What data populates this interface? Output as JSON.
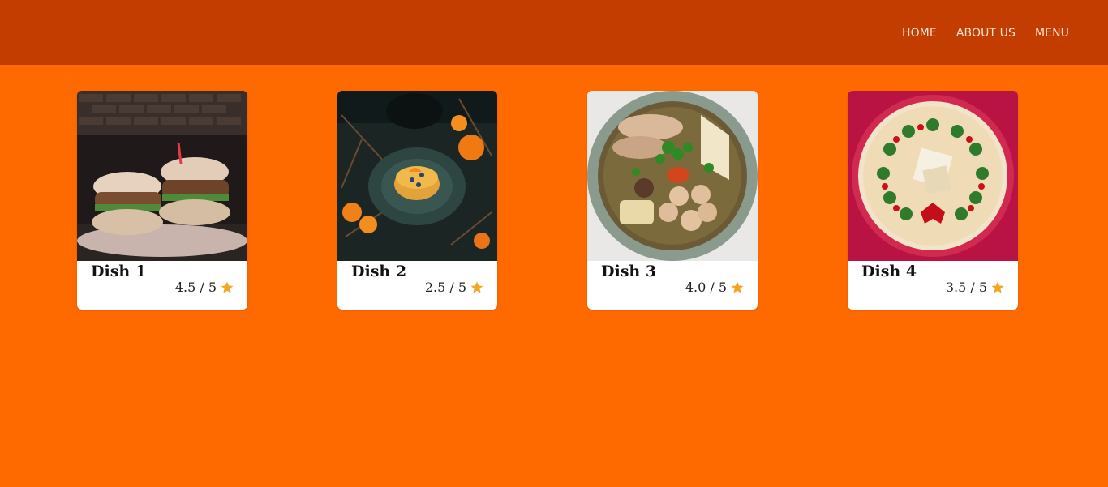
{
  "nav": {
    "items": [
      {
        "label": "HOME"
      },
      {
        "label": "ABOUT US"
      },
      {
        "label": "MENU"
      }
    ]
  },
  "dishes": [
    {
      "name": "Dish 1",
      "rating_text": "4.5 / 5",
      "rating": 4.5,
      "max": 5,
      "image": "burgers-photo"
    },
    {
      "name": "Dish 2",
      "rating_text": "2.5 / 5",
      "rating": 2.5,
      "max": 5,
      "image": "pancakes-photo"
    },
    {
      "name": "Dish 3",
      "rating_text": "4.0 / 5",
      "rating": 4.0,
      "max": 5,
      "image": "soup-bowl-photo"
    },
    {
      "name": "Dish 4",
      "rating_text": "3.5 / 5",
      "rating": 3.5,
      "max": 5,
      "image": "wreath-dish-photo"
    }
  ],
  "colors": {
    "page_bg": "#ff6a00",
    "header_bg": "#c33c00",
    "nav_text": "#fbe3d6",
    "star": "#f2a623"
  }
}
